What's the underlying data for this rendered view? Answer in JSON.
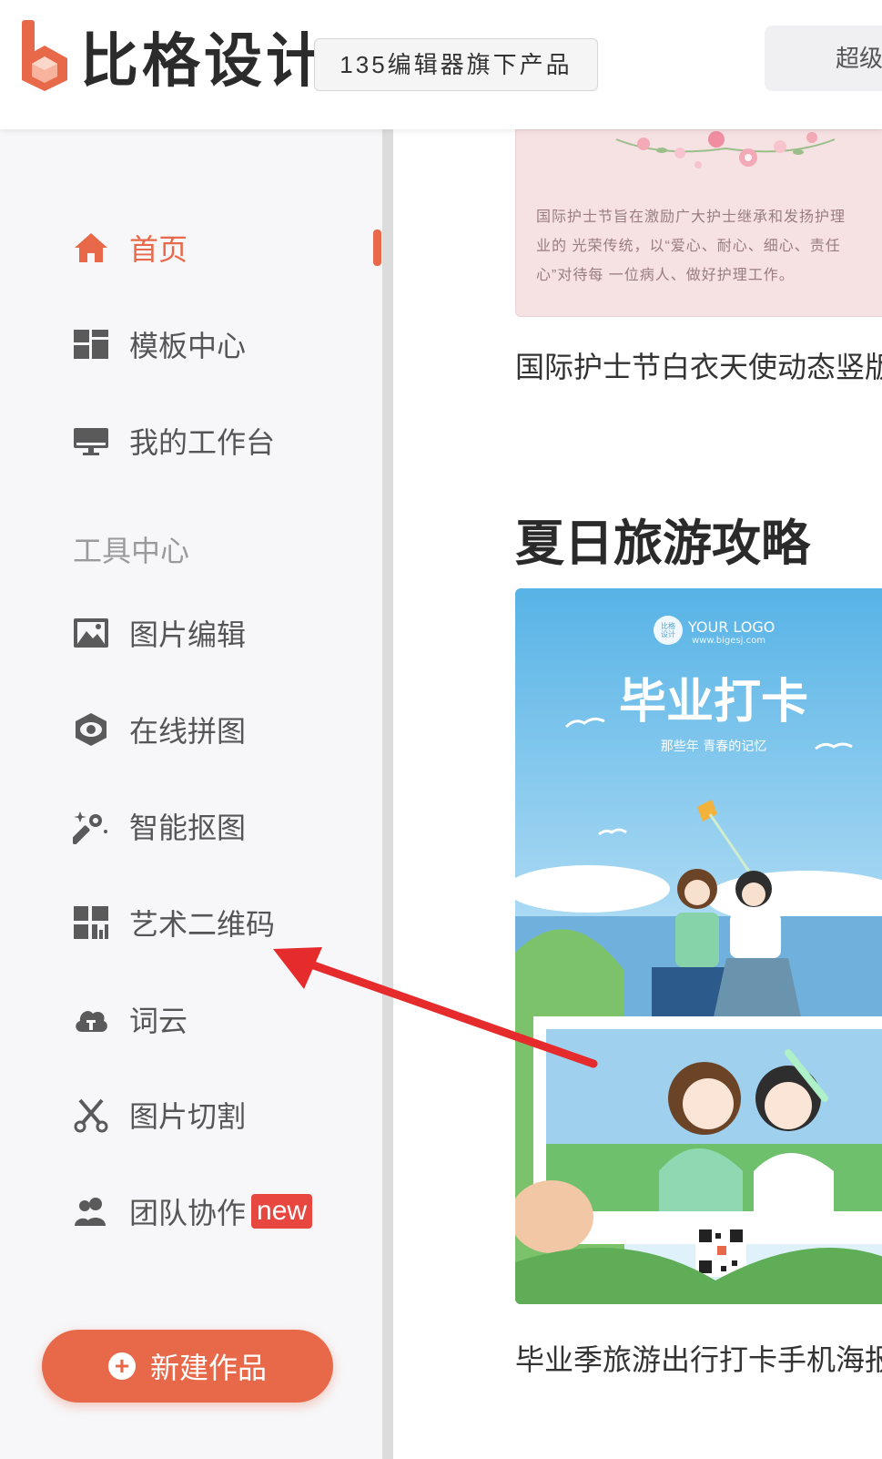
{
  "header": {
    "brand": "比格设计",
    "tagline": "135编辑器旗下产品",
    "right_button": "超级"
  },
  "sidebar": {
    "items": [
      {
        "label": "首页",
        "icon": "home-icon",
        "active": true
      },
      {
        "label": "模板中心",
        "icon": "grid-icon"
      },
      {
        "label": "我的工作台",
        "icon": "monitor-icon"
      }
    ],
    "section_label": "工具中心",
    "tools": [
      {
        "label": "图片编辑",
        "icon": "image-icon"
      },
      {
        "label": "在线拼图",
        "icon": "eye-hexagon-icon"
      },
      {
        "label": "智能抠图",
        "icon": "magic-wand-icon"
      },
      {
        "label": "艺术二维码",
        "icon": "qrcode-icon"
      },
      {
        "label": "词云",
        "icon": "cloud-icon"
      },
      {
        "label": "图片切割",
        "icon": "scissors-icon"
      },
      {
        "label": "团队协作",
        "icon": "team-icon",
        "badge": "new"
      }
    ],
    "new_button": "新建作品"
  },
  "main": {
    "card1": {
      "text_lines": [
        "国际护士节旨在激励广大护士继承和发扬护理",
        "业的 光荣传统，以“爱心、耐心、细心、责任",
        "心”对待每 一位病人、做好护理工作。"
      ],
      "title": "国际护士节白衣天使动态竖版"
    },
    "section_title": "夏日旅游攻略",
    "card2": {
      "logo_text": "YOUR LOGO",
      "logo_sub": "www.bigesj.com",
      "logo_badge": "比格\n设计",
      "headline": "毕业打卡",
      "subline": "那些年 青春的记忆",
      "title": "毕业季旅游出行打卡手机海报"
    }
  },
  "colors": {
    "accent": "#e8694a",
    "badge": "#e8473f",
    "arrow": "#e52b2b"
  }
}
